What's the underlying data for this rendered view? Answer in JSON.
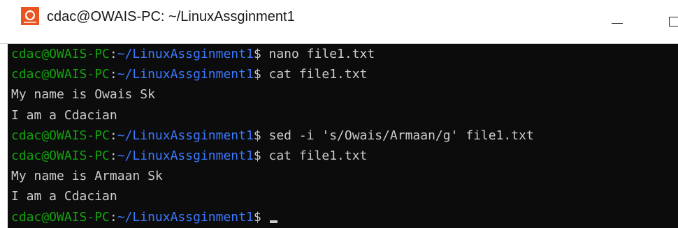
{
  "window": {
    "title": "cdac@OWAIS-PC: ~/LinuxAssginment1",
    "icon": "ubuntu-terminal-icon",
    "controls": {
      "minimize_icon": "minimize-icon",
      "maximize_icon": "maximize-icon"
    }
  },
  "colors": {
    "terminal_bg": "#0c0c0c",
    "prompt_user": "#13a10e",
    "prompt_path": "#3b78ff",
    "text": "#cccccc",
    "app_icon": "#e95420"
  },
  "terminal": {
    "lines": [
      {
        "type": "prompt",
        "user": "cdac@OWAIS-PC",
        "sep": ":",
        "path": "~/LinuxAssginment1",
        "symbol": "$ ",
        "command": "nano file1.txt"
      },
      {
        "type": "prompt",
        "user": "cdac@OWAIS-PC",
        "sep": ":",
        "path": "~/LinuxAssginment1",
        "symbol": "$ ",
        "command": "cat file1.txt"
      },
      {
        "type": "output",
        "text": "My name is Owais Sk"
      },
      {
        "type": "output",
        "text": "I am a Cdacian"
      },
      {
        "type": "prompt",
        "user": "cdac@OWAIS-PC",
        "sep": ":",
        "path": "~/LinuxAssginment1",
        "symbol": "$ ",
        "command": "sed -i 's/Owais/Armaan/g' file1.txt"
      },
      {
        "type": "prompt",
        "user": "cdac@OWAIS-PC",
        "sep": ":",
        "path": "~/LinuxAssginment1",
        "symbol": "$ ",
        "command": "cat file1.txt"
      },
      {
        "type": "output",
        "text": "My name is Armaan Sk"
      },
      {
        "type": "output",
        "text": "I am a Cdacian"
      },
      {
        "type": "prompt",
        "user": "cdac@OWAIS-PC",
        "sep": ":",
        "path": "~/LinuxAssginment1",
        "symbol": "$ ",
        "command": ""
      }
    ]
  }
}
